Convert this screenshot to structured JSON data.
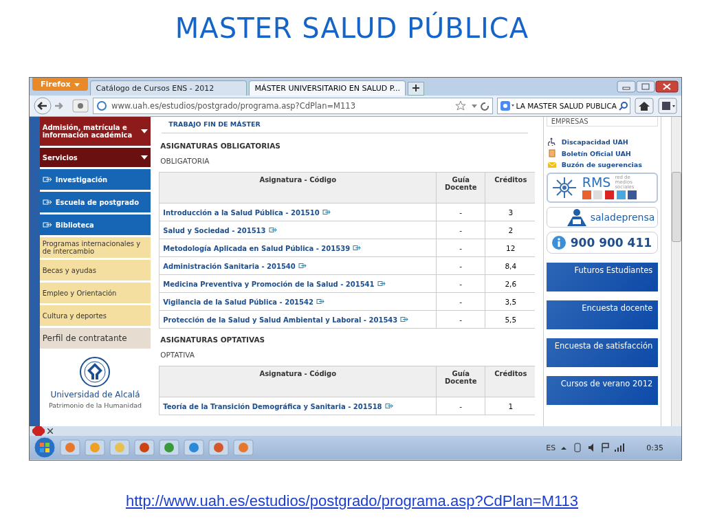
{
  "slide": {
    "title": "MASTER SALUD PÚBLICA",
    "link": "http://www.uah.es/estudios/postgrado/programa.asp?CdPlan=M113"
  },
  "browser": {
    "menu_button": "Firefox",
    "tabs": [
      {
        "label": "Catálogo de Cursos ENS - 2012",
        "selected": false
      },
      {
        "label": "MÁSTER UNIVERSITARIO EN SALUD P...",
        "selected": true
      }
    ],
    "address": "www.uah.es/estudios/postgrado/programa.asp?CdPlan=M113",
    "search": "LA MASTER SALUD PUBLICA"
  },
  "sidebar": {
    "items": [
      {
        "label": "Admisión, matrícula e información académica",
        "kind": "dropdown"
      },
      {
        "label": "Servicios",
        "kind": "dropdown-dark"
      },
      {
        "label": "Investigación",
        "kind": "link"
      },
      {
        "label": "Escuela de postgrado",
        "kind": "link"
      },
      {
        "label": "Biblioteca",
        "kind": "link"
      },
      {
        "label": "Programas internacionales y de intercambio",
        "kind": "plain"
      },
      {
        "label": "Becas y ayudas",
        "kind": "plain"
      },
      {
        "label": "Empleo y Orientación",
        "kind": "plain"
      },
      {
        "label": "Cultura y deportes",
        "kind": "plain"
      },
      {
        "label": "Perfil de contratante",
        "kind": "grey"
      }
    ],
    "logo": {
      "name": "Universidad de Alcalá",
      "tagline": "Patrimonio de la Humanidad"
    }
  },
  "content": {
    "cut_heading": "TRABAJO FIN DE MÁSTER",
    "sections": [
      {
        "heading": "ASIGNATURAS OBLIGATORIAS",
        "subheading": "OBLIGATORIA",
        "columns": [
          "Asignatura - Código",
          "Guía Docente",
          "Créditos"
        ],
        "rows": [
          {
            "subject": "Introducción a la Salud Pública - 201510",
            "guide": "-",
            "credits": "3"
          },
          {
            "subject": "Salud y Sociedad - 201513",
            "guide": "-",
            "credits": "2"
          },
          {
            "subject": "Metodología Aplicada en Salud Pública - 201539",
            "guide": "-",
            "credits": "12"
          },
          {
            "subject": "Administración Sanitaria - 201540",
            "guide": "-",
            "credits": "8,4"
          },
          {
            "subject": "Medicina Preventiva y Promoción de la Salud - 201541",
            "guide": "-",
            "credits": "2,6"
          },
          {
            "subject": "Vigilancia de la Salud Pública - 201542",
            "guide": "-",
            "credits": "3,5"
          },
          {
            "subject": "Protección de la Salud y Salud Ambiental y Laboral - 201543",
            "guide": "-",
            "credits": "5,5"
          }
        ]
      },
      {
        "heading": "ASIGNATURAS OPTATIVAS",
        "subheading": "OPTATIVA",
        "columns": [
          "Asignatura - Código",
          "Guía Docente",
          "Créditos"
        ],
        "rows": [
          {
            "subject": "Teoría de la Transición Demográfica y Sanitaria - 201518",
            "guide": "-",
            "credits": "1"
          }
        ]
      }
    ]
  },
  "right": {
    "cut_heading": "EMPRESAS",
    "links": [
      {
        "label": "Discapacidad UAH",
        "kind": "accessibility"
      },
      {
        "label": "Boletín Oficial UAH",
        "kind": "bulletin"
      },
      {
        "label": "Buzón de sugerencias",
        "kind": "mail"
      }
    ],
    "rms": {
      "title": "RMS",
      "subtitle": "red de medios sociales"
    },
    "press": "saladeprensa",
    "phone": "900 900 411",
    "banners": [
      "Futuros Estudiantes",
      "Encuesta docente",
      "Encuesta de satisfacción",
      "Cursos de verano 2012"
    ]
  },
  "taskbar": {
    "language": "ES",
    "clock": "0:35"
  }
}
